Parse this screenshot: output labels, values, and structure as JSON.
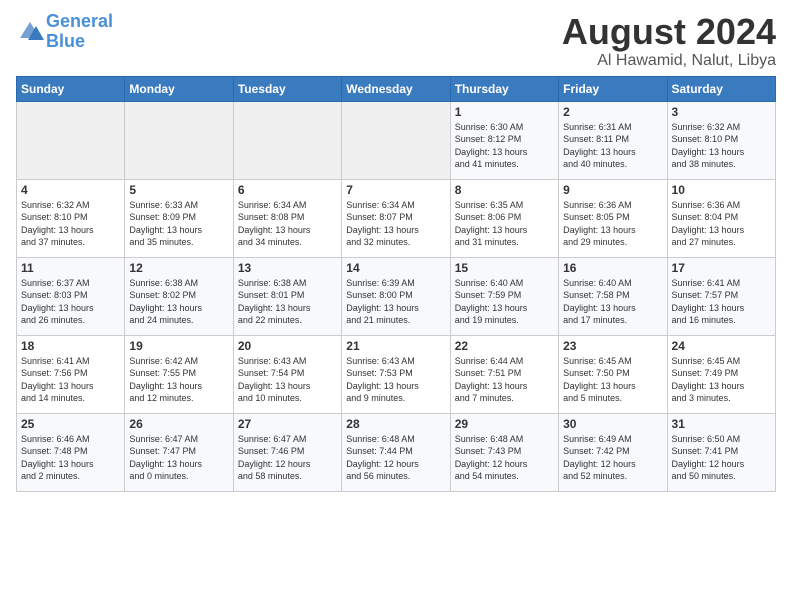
{
  "header": {
    "logo_line1": "General",
    "logo_line2": "Blue",
    "month_year": "August 2024",
    "location": "Al Hawamid, Nalut, Libya"
  },
  "days_of_week": [
    "Sunday",
    "Monday",
    "Tuesday",
    "Wednesday",
    "Thursday",
    "Friday",
    "Saturday"
  ],
  "weeks": [
    [
      {
        "day": "",
        "info": ""
      },
      {
        "day": "",
        "info": ""
      },
      {
        "day": "",
        "info": ""
      },
      {
        "day": "",
        "info": ""
      },
      {
        "day": "1",
        "info": "Sunrise: 6:30 AM\nSunset: 8:12 PM\nDaylight: 13 hours\nand 41 minutes."
      },
      {
        "day": "2",
        "info": "Sunrise: 6:31 AM\nSunset: 8:11 PM\nDaylight: 13 hours\nand 40 minutes."
      },
      {
        "day": "3",
        "info": "Sunrise: 6:32 AM\nSunset: 8:10 PM\nDaylight: 13 hours\nand 38 minutes."
      }
    ],
    [
      {
        "day": "4",
        "info": "Sunrise: 6:32 AM\nSunset: 8:10 PM\nDaylight: 13 hours\nand 37 minutes."
      },
      {
        "day": "5",
        "info": "Sunrise: 6:33 AM\nSunset: 8:09 PM\nDaylight: 13 hours\nand 35 minutes."
      },
      {
        "day": "6",
        "info": "Sunrise: 6:34 AM\nSunset: 8:08 PM\nDaylight: 13 hours\nand 34 minutes."
      },
      {
        "day": "7",
        "info": "Sunrise: 6:34 AM\nSunset: 8:07 PM\nDaylight: 13 hours\nand 32 minutes."
      },
      {
        "day": "8",
        "info": "Sunrise: 6:35 AM\nSunset: 8:06 PM\nDaylight: 13 hours\nand 31 minutes."
      },
      {
        "day": "9",
        "info": "Sunrise: 6:36 AM\nSunset: 8:05 PM\nDaylight: 13 hours\nand 29 minutes."
      },
      {
        "day": "10",
        "info": "Sunrise: 6:36 AM\nSunset: 8:04 PM\nDaylight: 13 hours\nand 27 minutes."
      }
    ],
    [
      {
        "day": "11",
        "info": "Sunrise: 6:37 AM\nSunset: 8:03 PM\nDaylight: 13 hours\nand 26 minutes."
      },
      {
        "day": "12",
        "info": "Sunrise: 6:38 AM\nSunset: 8:02 PM\nDaylight: 13 hours\nand 24 minutes."
      },
      {
        "day": "13",
        "info": "Sunrise: 6:38 AM\nSunset: 8:01 PM\nDaylight: 13 hours\nand 22 minutes."
      },
      {
        "day": "14",
        "info": "Sunrise: 6:39 AM\nSunset: 8:00 PM\nDaylight: 13 hours\nand 21 minutes."
      },
      {
        "day": "15",
        "info": "Sunrise: 6:40 AM\nSunset: 7:59 PM\nDaylight: 13 hours\nand 19 minutes."
      },
      {
        "day": "16",
        "info": "Sunrise: 6:40 AM\nSunset: 7:58 PM\nDaylight: 13 hours\nand 17 minutes."
      },
      {
        "day": "17",
        "info": "Sunrise: 6:41 AM\nSunset: 7:57 PM\nDaylight: 13 hours\nand 16 minutes."
      }
    ],
    [
      {
        "day": "18",
        "info": "Sunrise: 6:41 AM\nSunset: 7:56 PM\nDaylight: 13 hours\nand 14 minutes."
      },
      {
        "day": "19",
        "info": "Sunrise: 6:42 AM\nSunset: 7:55 PM\nDaylight: 13 hours\nand 12 minutes."
      },
      {
        "day": "20",
        "info": "Sunrise: 6:43 AM\nSunset: 7:54 PM\nDaylight: 13 hours\nand 10 minutes."
      },
      {
        "day": "21",
        "info": "Sunrise: 6:43 AM\nSunset: 7:53 PM\nDaylight: 13 hours\nand 9 minutes."
      },
      {
        "day": "22",
        "info": "Sunrise: 6:44 AM\nSunset: 7:51 PM\nDaylight: 13 hours\nand 7 minutes."
      },
      {
        "day": "23",
        "info": "Sunrise: 6:45 AM\nSunset: 7:50 PM\nDaylight: 13 hours\nand 5 minutes."
      },
      {
        "day": "24",
        "info": "Sunrise: 6:45 AM\nSunset: 7:49 PM\nDaylight: 13 hours\nand 3 minutes."
      }
    ],
    [
      {
        "day": "25",
        "info": "Sunrise: 6:46 AM\nSunset: 7:48 PM\nDaylight: 13 hours\nand 2 minutes."
      },
      {
        "day": "26",
        "info": "Sunrise: 6:47 AM\nSunset: 7:47 PM\nDaylight: 13 hours\nand 0 minutes."
      },
      {
        "day": "27",
        "info": "Sunrise: 6:47 AM\nSunset: 7:46 PM\nDaylight: 12 hours\nand 58 minutes."
      },
      {
        "day": "28",
        "info": "Sunrise: 6:48 AM\nSunset: 7:44 PM\nDaylight: 12 hours\nand 56 minutes."
      },
      {
        "day": "29",
        "info": "Sunrise: 6:48 AM\nSunset: 7:43 PM\nDaylight: 12 hours\nand 54 minutes."
      },
      {
        "day": "30",
        "info": "Sunrise: 6:49 AM\nSunset: 7:42 PM\nDaylight: 12 hours\nand 52 minutes."
      },
      {
        "day": "31",
        "info": "Sunrise: 6:50 AM\nSunset: 7:41 PM\nDaylight: 12 hours\nand 50 minutes."
      }
    ]
  ]
}
